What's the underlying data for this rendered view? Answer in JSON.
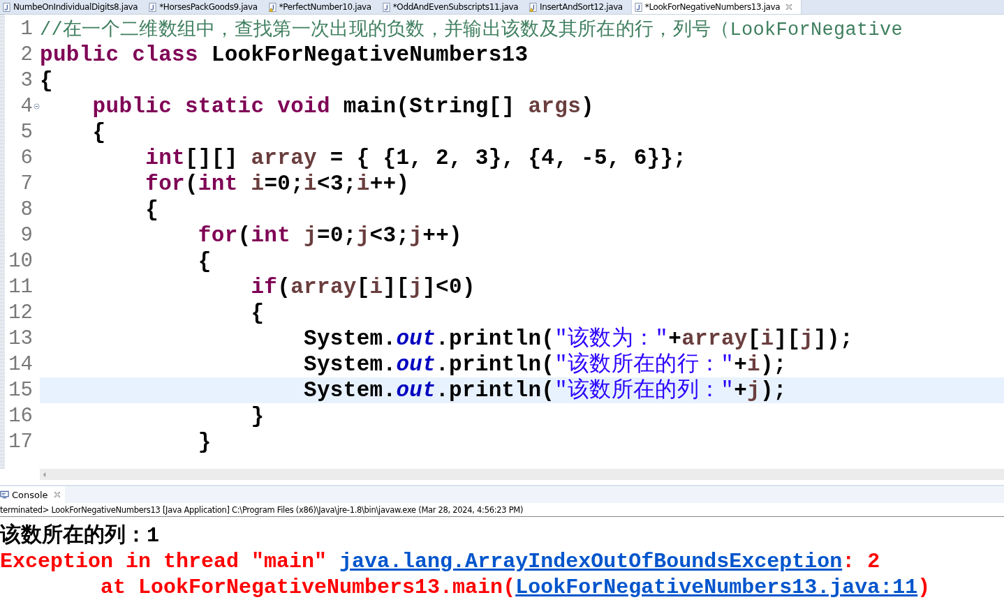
{
  "tabs": [
    {
      "label": "NumbeOnIndividualDigits8.java",
      "kind": "normal",
      "selected": false
    },
    {
      "label": "*HorsesPackGoods9.java",
      "kind": "normal",
      "selected": false
    },
    {
      "label": "*PerfectNumber10.java",
      "kind": "warned",
      "selected": false
    },
    {
      "label": "*OddAndEvenSubscripts11.java",
      "kind": "normal",
      "selected": false
    },
    {
      "label": "InsertAndSort12.java",
      "kind": "warned",
      "selected": false
    },
    {
      "label": "*LookForNegativeNumbers13.java",
      "kind": "normal",
      "selected": true
    }
  ],
  "editor": {
    "lines": [
      {
        "number": "1",
        "current": false,
        "tokens": [
          {
            "kind": "comment",
            "text": "//在一个二维数组中，查找第一次出现的负数，并输出该数及其所在的行，列号（LookForNegative"
          }
        ]
      },
      {
        "number": "2",
        "current": false,
        "tokens": [
          {
            "kind": "keyword",
            "text": "public class"
          },
          {
            "kind": "plain",
            "text": " LookForNegativeNumbers13"
          }
        ]
      },
      {
        "number": "3",
        "current": false,
        "tokens": [
          {
            "kind": "plain",
            "text": "{"
          }
        ]
      },
      {
        "number": "4",
        "current": false,
        "fold": true,
        "tokens": [
          {
            "kind": "keyword",
            "text": "    public static void"
          },
          {
            "kind": "plain",
            "text": " main(String[] "
          },
          {
            "kind": "variable",
            "text": "args"
          },
          {
            "kind": "plain",
            "text": ")"
          }
        ]
      },
      {
        "number": "5",
        "current": false,
        "tokens": [
          {
            "kind": "plain",
            "text": "    {"
          }
        ]
      },
      {
        "number": "6",
        "current": false,
        "tokens": [
          {
            "kind": "keyword",
            "text": "        int"
          },
          {
            "kind": "plain",
            "text": "[][] "
          },
          {
            "kind": "variable",
            "text": "array"
          },
          {
            "kind": "plain",
            "text": " = { {1, 2, 3}, {4, -5, 6}};"
          }
        ]
      },
      {
        "number": "7",
        "current": false,
        "tokens": [
          {
            "kind": "keyword",
            "text": "        for"
          },
          {
            "kind": "plain",
            "text": "("
          },
          {
            "kind": "keyword",
            "text": "int "
          },
          {
            "kind": "variable",
            "text": "i"
          },
          {
            "kind": "plain",
            "text": "=0;"
          },
          {
            "kind": "variable",
            "text": "i"
          },
          {
            "kind": "plain",
            "text": "<3;"
          },
          {
            "kind": "variable",
            "text": "i"
          },
          {
            "kind": "plain",
            "text": "++)"
          }
        ]
      },
      {
        "number": "8",
        "current": false,
        "tokens": [
          {
            "kind": "plain",
            "text": "        {"
          }
        ]
      },
      {
        "number": "9",
        "current": false,
        "tokens": [
          {
            "kind": "keyword",
            "text": "            for"
          },
          {
            "kind": "plain",
            "text": "("
          },
          {
            "kind": "keyword",
            "text": "int "
          },
          {
            "kind": "variable",
            "text": "j"
          },
          {
            "kind": "plain",
            "text": "=0;"
          },
          {
            "kind": "variable",
            "text": "j"
          },
          {
            "kind": "plain",
            "text": "<3;"
          },
          {
            "kind": "variable",
            "text": "j"
          },
          {
            "kind": "plain",
            "text": "++)"
          }
        ]
      },
      {
        "number": "10",
        "current": false,
        "tokens": [
          {
            "kind": "plain",
            "text": "            {"
          }
        ]
      },
      {
        "number": "11",
        "current": false,
        "tokens": [
          {
            "kind": "keyword",
            "text": "                if"
          },
          {
            "kind": "plain",
            "text": "("
          },
          {
            "kind": "variable",
            "text": "array"
          },
          {
            "kind": "plain",
            "text": "["
          },
          {
            "kind": "variable",
            "text": "i"
          },
          {
            "kind": "plain",
            "text": "]["
          },
          {
            "kind": "variable",
            "text": "j"
          },
          {
            "kind": "plain",
            "text": "]<0)"
          }
        ]
      },
      {
        "number": "12",
        "current": false,
        "tokens": [
          {
            "kind": "plain",
            "text": "                {"
          }
        ]
      },
      {
        "number": "13",
        "current": false,
        "tokens": [
          {
            "kind": "plain",
            "text": "                    System."
          },
          {
            "kind": "field",
            "text": "out"
          },
          {
            "kind": "plain",
            "text": ".println("
          },
          {
            "kind": "string",
            "text": "\"该数为：\""
          },
          {
            "kind": "plain",
            "text": "+"
          },
          {
            "kind": "variable",
            "text": "array"
          },
          {
            "kind": "plain",
            "text": "["
          },
          {
            "kind": "variable",
            "text": "i"
          },
          {
            "kind": "plain",
            "text": "]["
          },
          {
            "kind": "variable",
            "text": "j"
          },
          {
            "kind": "plain",
            "text": "]);"
          }
        ]
      },
      {
        "number": "14",
        "current": false,
        "tokens": [
          {
            "kind": "plain",
            "text": "                    System."
          },
          {
            "kind": "field",
            "text": "out"
          },
          {
            "kind": "plain",
            "text": ".println("
          },
          {
            "kind": "string",
            "text": "\"该数所在的行：\""
          },
          {
            "kind": "plain",
            "text": "+"
          },
          {
            "kind": "variable",
            "text": "i"
          },
          {
            "kind": "plain",
            "text": ");"
          }
        ]
      },
      {
        "number": "15",
        "current": true,
        "tokens": [
          {
            "kind": "plain",
            "text": "                    System."
          },
          {
            "kind": "field",
            "text": "out"
          },
          {
            "kind": "plain",
            "text": ".println("
          },
          {
            "kind": "string",
            "text": "\"该数所在的列：\""
          },
          {
            "kind": "plain",
            "text": "+"
          },
          {
            "kind": "variable",
            "text": "j"
          },
          {
            "kind": "plain",
            "text": ");"
          }
        ]
      },
      {
        "number": "16",
        "current": false,
        "tokens": [
          {
            "kind": "plain",
            "text": "                }"
          }
        ]
      },
      {
        "number": "17",
        "current": false,
        "tokens": [
          {
            "kind": "plain",
            "text": "            }"
          }
        ]
      }
    ]
  },
  "console": {
    "tab": "Console",
    "status": "terminated> LookForNegativeNumbers13 [Java Application] C:\\Program Files (x86)\\Java\\jre-1.8\\bin\\javaw.exe (Mar 28, 2024, 4:56:23 PM)",
    "lines": [
      {
        "parts": [
          {
            "kind": "out",
            "text": "该数所在的列：1"
          }
        ]
      },
      {
        "parts": [
          {
            "kind": "err",
            "text": "Exception in thread \"main\" "
          },
          {
            "kind": "link",
            "text": "java.lang.ArrayIndexOutOfBoundsException"
          },
          {
            "kind": "err",
            "text": ": 2"
          }
        ]
      },
      {
        "parts": [
          {
            "kind": "err",
            "text": "\tat LookForNegativeNumbers13.main("
          },
          {
            "kind": "link",
            "text": "LookForNegativeNumbers13.java:11"
          },
          {
            "kind": "err",
            "text": ")"
          }
        ]
      }
    ]
  }
}
